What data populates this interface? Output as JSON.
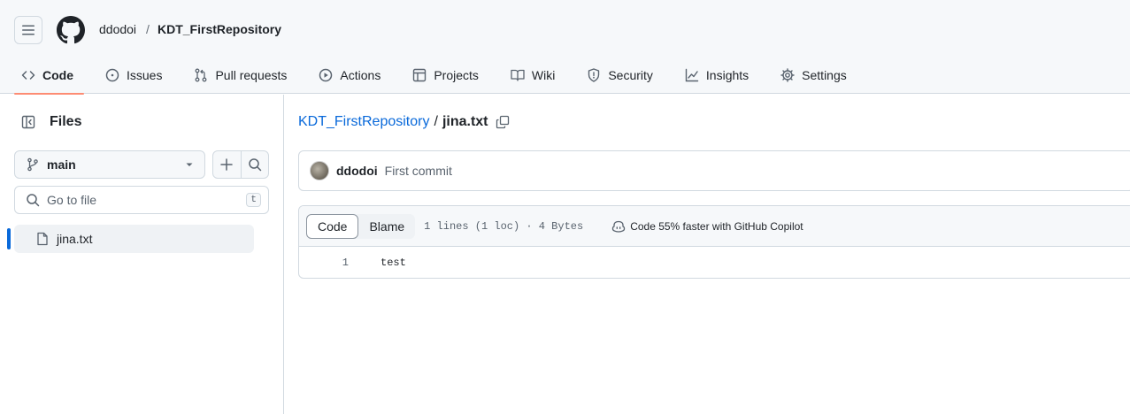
{
  "header": {
    "owner": "ddodoi",
    "separator": "/",
    "repo": "KDT_FirstRepository"
  },
  "nav": {
    "tabs": [
      {
        "label": "Code",
        "icon": "code-icon",
        "selected": true
      },
      {
        "label": "Issues",
        "icon": "issue-opened-icon"
      },
      {
        "label": "Pull requests",
        "icon": "git-pull-request-icon"
      },
      {
        "label": "Actions",
        "icon": "play-icon"
      },
      {
        "label": "Projects",
        "icon": "table-icon"
      },
      {
        "label": "Wiki",
        "icon": "book-icon"
      },
      {
        "label": "Security",
        "icon": "shield-icon"
      },
      {
        "label": "Insights",
        "icon": "graph-icon"
      },
      {
        "label": "Settings",
        "icon": "gear-icon"
      }
    ]
  },
  "sidebar": {
    "title": "Files",
    "branch": "main",
    "goto_placeholder": "Go to file",
    "goto_shortcut": "t",
    "tree": [
      {
        "name": "jina.txt",
        "icon": "file-icon",
        "selected": true
      }
    ]
  },
  "main": {
    "breadcrumb": {
      "repo": "KDT_FirstRepository",
      "separator": "/",
      "file": "jina.txt"
    },
    "commit": {
      "author": "ddodoi",
      "message": "First commit"
    },
    "file": {
      "view_tabs": [
        "Code",
        "Blame"
      ],
      "active_view": "Code",
      "meta": "1 lines (1 loc) · 4 Bytes",
      "copilot_text": "Code 55% faster with GitHub Copilot",
      "lines": [
        {
          "number": "1",
          "text": "test"
        }
      ]
    }
  },
  "colors": {
    "accent_link": "#0969da",
    "tab_underline": "#fd8c73",
    "border": "#d1d9e0",
    "header_bg": "#f6f8fa"
  }
}
